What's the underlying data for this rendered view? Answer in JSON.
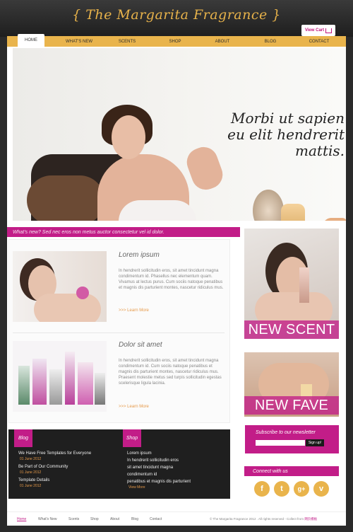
{
  "header": {
    "logo": "{ The Margarita Fragrance }",
    "cart_label": "View Cart"
  },
  "nav": {
    "items": [
      {
        "label": "HOME",
        "active": true
      },
      {
        "label": "WHAT'S NEW"
      },
      {
        "label": "SCENTS"
      },
      {
        "label": "SHOP"
      },
      {
        "label": "ABOUT"
      },
      {
        "label": "BLOG"
      },
      {
        "label": "CONTACT"
      }
    ]
  },
  "hero": {
    "title_line1": "Morbi ut sapien",
    "title_line2": "eu elit hendrerit",
    "title_line3": "mattis."
  },
  "tagline": "What's new? Sed nec eros non metus auctor consectetur vel id dolor.",
  "articles": [
    {
      "title": "Lorem ipsum",
      "body": "In hendrerit sollicitudin eros, sit amet tincidunt magna condimentum id. Phasellus nec elementum quam. Vivamus at lectus purus. Cum sociis natoque penatibus et magnis dis parturient montes, nascetur ridiculus mus.",
      "more": ">>> Learn More"
    },
    {
      "title": "Dolor sit amet",
      "body": "In hendrerit sollicitudin eros, sit amet tincidunt magna condimentum id. Cum sociis natoque penatibus et magnis dis parturient montes, nascetur ridiculus mus. Praesent molestie metus sed turpis sollicitudin egestas scelerisque ligula lacinia.",
      "more": ">>> Learn More"
    }
  ],
  "side_cards": [
    {
      "label": "NEW SCENT"
    },
    {
      "label": "NEW FAVE"
    }
  ],
  "blog": {
    "title": "Blog",
    "items": [
      {
        "text": "We Have Free Templates for Everyone",
        "date": "01 June 2012"
      },
      {
        "text": "Be Part of Our Community",
        "date": "01 June 2012"
      },
      {
        "text": "Template Details",
        "date": "01 June 2012"
      }
    ]
  },
  "shop": {
    "title": "Shop",
    "items": [
      "Lorem ipsum",
      "In hendrerit sollicitudin eros",
      "sit amet tincidunt magna",
      "condimentum id",
      "penatibus et magnis dis parturient"
    ],
    "more": "View More"
  },
  "newsletter": {
    "title": "Subscribe to our newsletter",
    "button": "Sign up!"
  },
  "connect": {
    "title": "Connect with us",
    "icons": [
      "f",
      "t",
      "g+",
      "v"
    ]
  },
  "footer": {
    "links": [
      "Home",
      "What's New",
      "Scents",
      "Shop",
      "About",
      "Blog",
      "Contact"
    ],
    "copyright": "© The Margarita Fragrance 2012 . All rights reserved - Collect from",
    "copyright_link": "网页模板"
  },
  "colors": {
    "accent": "#c21d88",
    "gold": "#e9b44c",
    "dark": "#1f1f1f"
  }
}
